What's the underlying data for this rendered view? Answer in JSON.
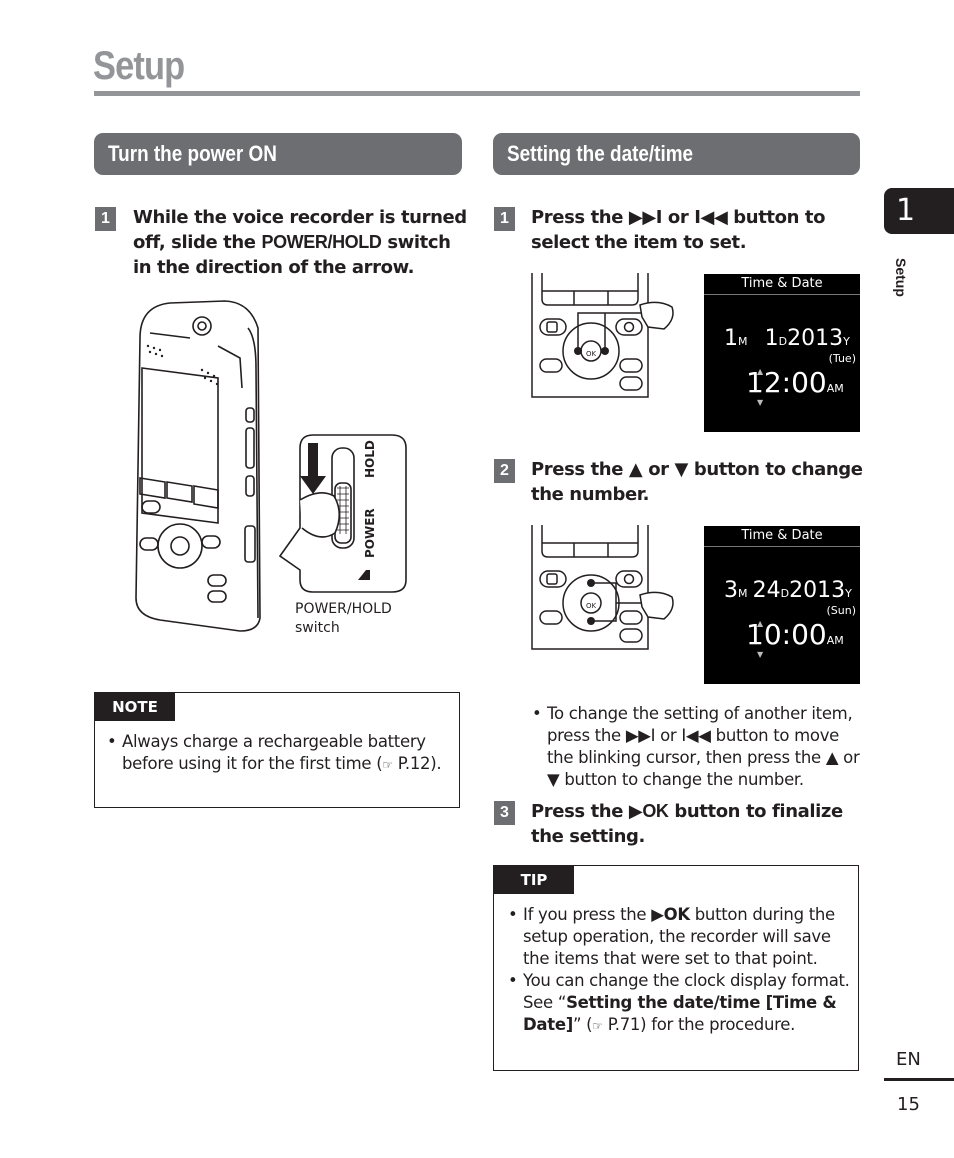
{
  "page": {
    "title": "Setup",
    "side_tab_number": "1",
    "side_tab_label": "Setup",
    "language": "EN",
    "page_number": "15"
  },
  "left_section": {
    "heading": "Turn the power ON",
    "step1": {
      "number": "1",
      "text_before": "While the voice recorder is turned off, slide the ",
      "switch_name": "POWER/HOLD",
      "text_after": " switch in the direction of the arrow."
    },
    "illustration": {
      "switch_label_hold": "HOLD",
      "switch_label_power": "POWER",
      "caption_line1": "POWER/HOLD",
      "caption_line2": "switch"
    },
    "note": {
      "label": "NOTE",
      "items": [
        {
          "text": "Always charge a rechargeable battery before using it for the first time (",
          "ref_icon": "☞",
          "ref": " P.12",
          "tail": ")."
        }
      ]
    }
  },
  "right_section": {
    "heading": "Setting the date/time",
    "step1": {
      "number": "1",
      "text_a": "Press the ",
      "icon_next": "▶▶I",
      "text_b": " or ",
      "icon_prev": "I◀◀",
      "text_c": " button to select the item to set."
    },
    "screen1": {
      "title": "Time & Date",
      "month": "1",
      "month_unit": "M",
      "day": "1",
      "day_unit": "D",
      "year": "2013",
      "year_unit": "Y",
      "weekday": "(Tue)",
      "time": "12:00",
      "ampm": "AM"
    },
    "step2": {
      "number": "2",
      "text_a": "Press the ",
      "icon_up": "▲",
      "text_b": " or ",
      "icon_down": "▼",
      "text_c": " button to change the number."
    },
    "screen2": {
      "title": "Time & Date",
      "month": "3",
      "month_unit": "M",
      "day": "24",
      "day_unit": "D",
      "year": "2013",
      "year_unit": "Y",
      "weekday": "(Sun)",
      "time": "10:00",
      "ampm": "AM"
    },
    "step2_bullet": {
      "a": "To change the setting of another item, press the ",
      "icon_next": "▶▶I",
      "b": " or ",
      "icon_prev": "I◀◀",
      "c": " button to move the blinking cursor, then press the ",
      "icon_up": "▲",
      "d": " or ",
      "icon_down": "▼",
      "e": " button to change the number."
    },
    "step3": {
      "number": "3",
      "text_a": "Press the ",
      "icon_play": "▶",
      "ok": "OK",
      "text_b": " button to finalize the setting."
    },
    "tip": {
      "label": "TIP",
      "item1": {
        "a": "If you press the ",
        "icon_play": "▶",
        "ok": "OK",
        "b": " button during the setup operation, the recorder will save the items that were set to that point."
      },
      "item2": {
        "a": "You can change the clock display format. See “",
        "bold": "Setting the date/time [Time & Date]",
        "b": "” (",
        "ref_icon": "☞",
        "ref": " P.71",
        "c": ") for the procedure."
      }
    }
  }
}
